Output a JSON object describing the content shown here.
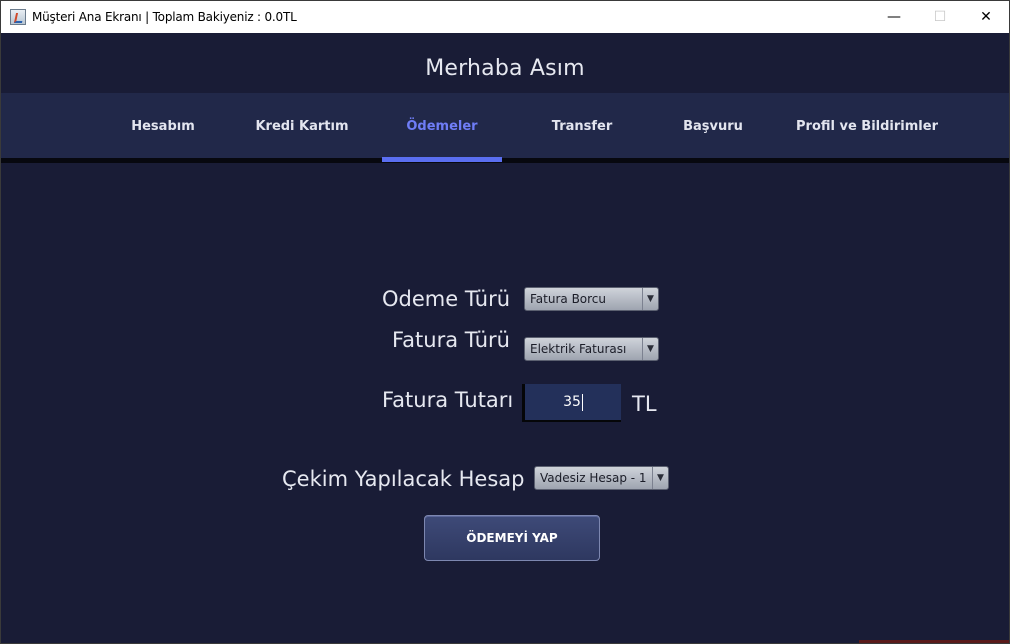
{
  "window": {
    "title": "Müşteri Ana Ekranı | Toplam Bakiyeniz : 0.0TL",
    "minimize_glyph": "—",
    "maximize_glyph": "☐",
    "close_glyph": "✕"
  },
  "header": {
    "greeting": "Merhaba Asım"
  },
  "tabs": {
    "hesabim": "Hesabım",
    "kredi_karti": "Kredi Kartım",
    "odemeler": "Ödemeler",
    "transfer": "Transfer",
    "basvuru": "Başvuru",
    "profil": "Profil ve Bildirimler",
    "active": "Ödemeler"
  },
  "form": {
    "odeme_turu_label": "Odeme Türü",
    "odeme_turu_value": "Fatura Borcu",
    "fatura_turu_label": "Fatura Türü",
    "fatura_turu_value": "Elektrik Faturası",
    "fatura_tutari_label": "Fatura Tutarı",
    "fatura_tutari_value": "35",
    "currency": "TL",
    "cekim_hesap_label": "Çekim Yapılacak Hesap",
    "cekim_hesap_value": "Vadesiz Hesap - 1",
    "submit_label": "ÖDEMEYİ YAP",
    "dropdown_arrow": "▼"
  },
  "colors": {
    "background": "#191c36",
    "tabbar": "#212849",
    "accent": "#5a6ef0",
    "active_tab_text": "#6f7df6"
  }
}
